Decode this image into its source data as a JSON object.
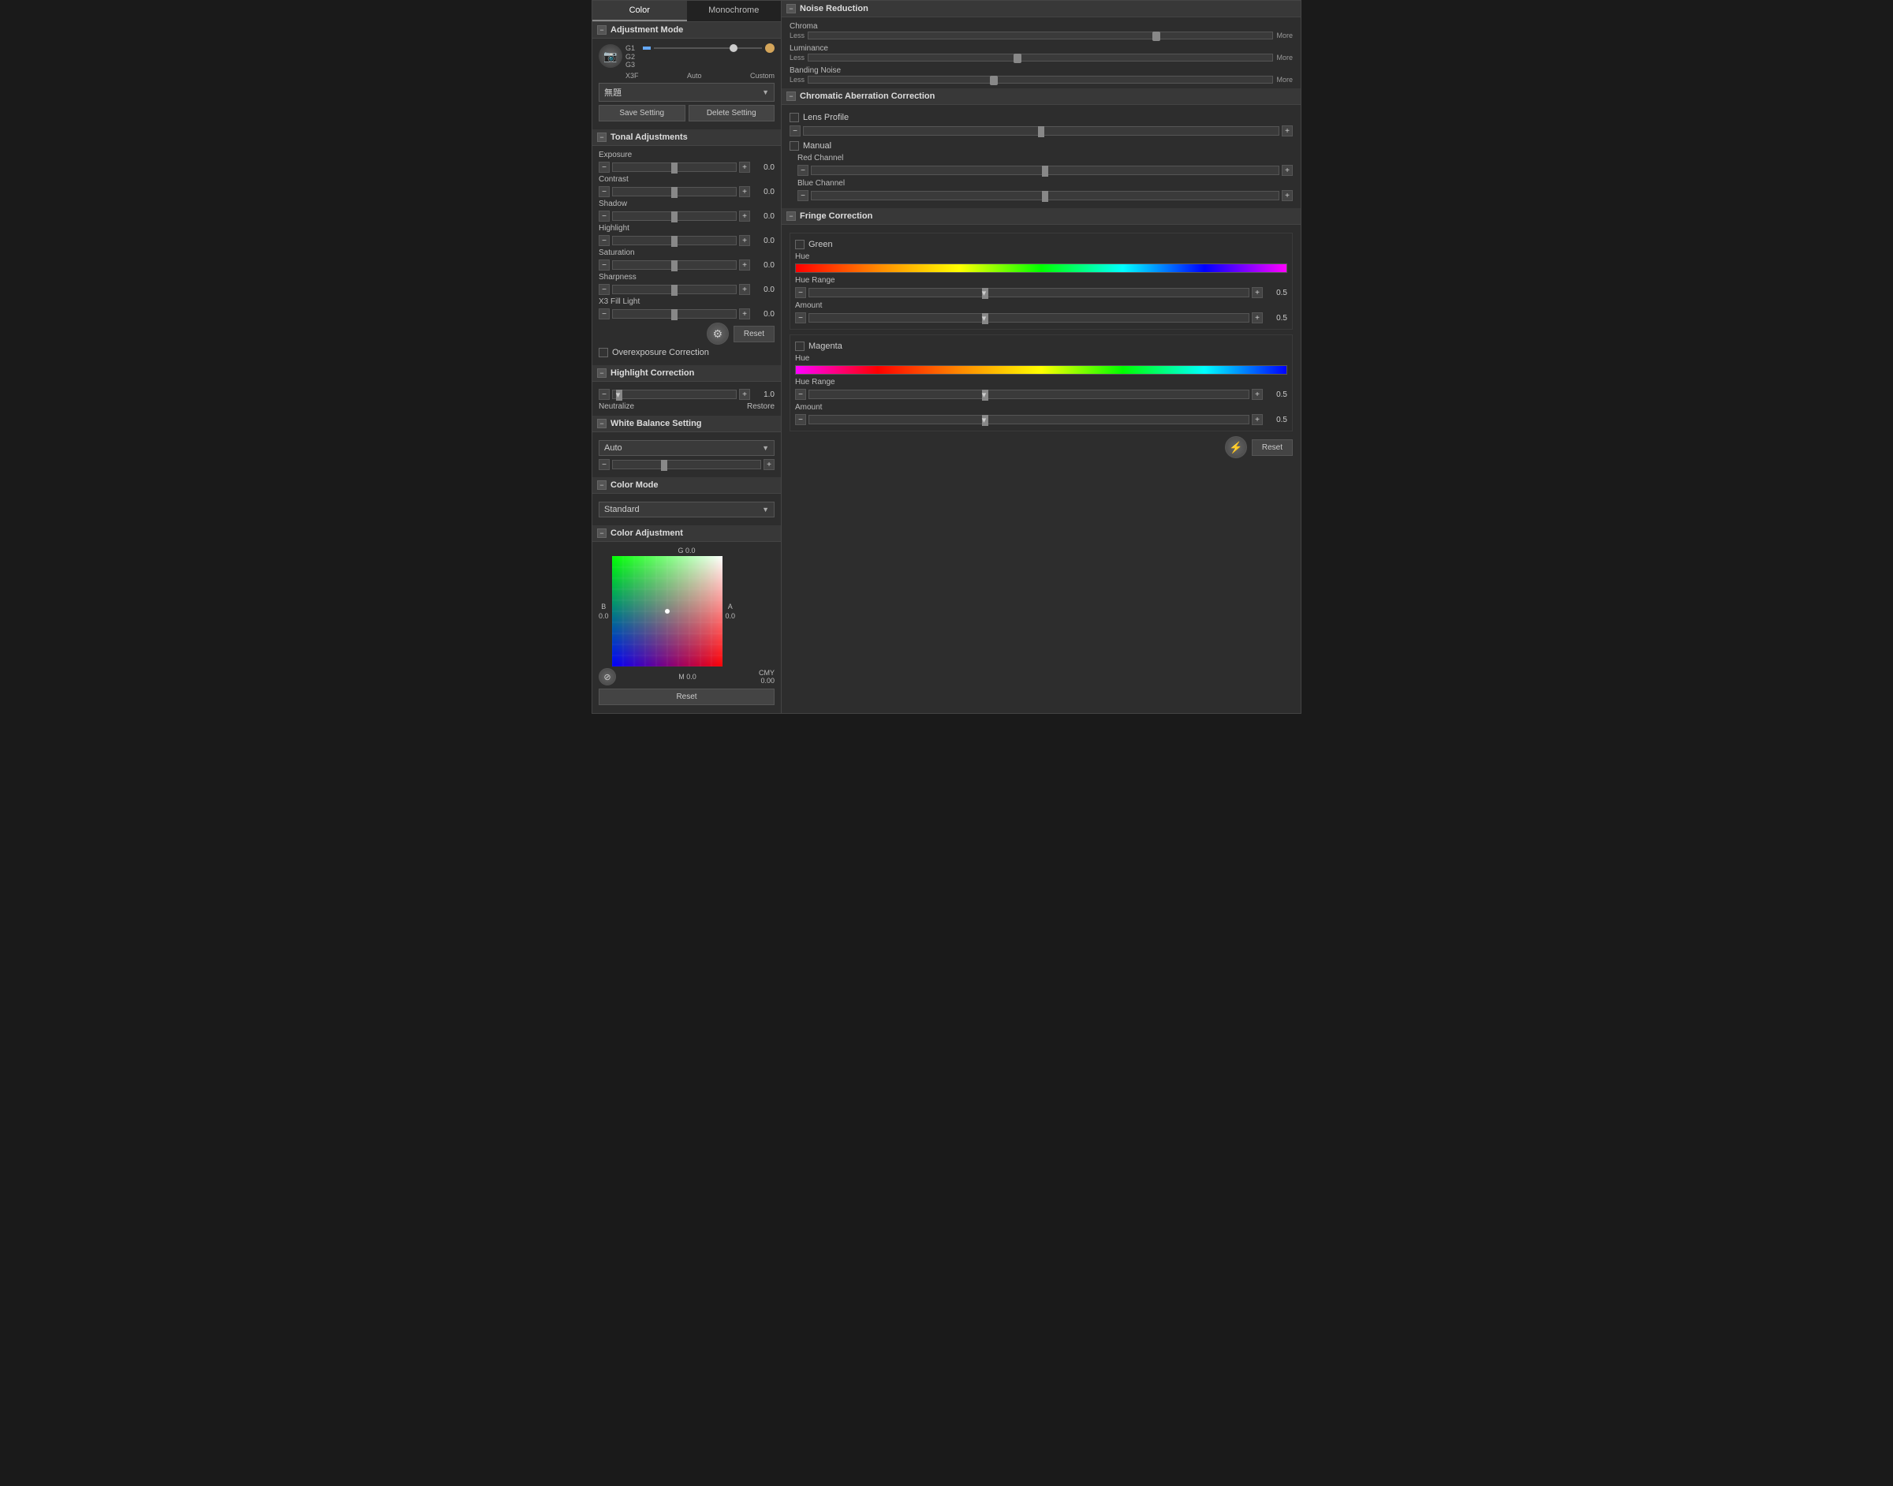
{
  "tabs": {
    "color_label": "Color",
    "monochrome_label": "Monochrome"
  },
  "left_panel": {
    "adjustment_mode": {
      "title": "Adjustment Mode",
      "film_labels": [
        "G1",
        "G2",
        "G3"
      ],
      "mode_labels": [
        "X3F",
        "Auto",
        "Custom"
      ],
      "dropdown_value": "無題",
      "save_button": "Save Setting",
      "delete_button": "Delete Setting"
    },
    "tonal_adjustments": {
      "title": "Tonal Adjustments",
      "sliders": [
        {
          "label": "Exposure",
          "value": "0.0"
        },
        {
          "label": "Contrast",
          "value": "0.0"
        },
        {
          "label": "Shadow",
          "value": "0.0"
        },
        {
          "label": "Highlight",
          "value": "0.0"
        },
        {
          "label": "Saturation",
          "value": "0.0"
        },
        {
          "label": "Sharpness",
          "value": "0.0"
        },
        {
          "label": "X3 Fill Light",
          "value": "0.0"
        }
      ],
      "reset_button": "Reset",
      "overexposure_label": "Overexposure Correction"
    },
    "highlight_correction": {
      "title": "Highlight Correction",
      "value": "1.0",
      "neutralize": "Neutralize",
      "restore": "Restore"
    },
    "white_balance": {
      "title": "White Balance Setting",
      "dropdown_value": "Auto"
    },
    "color_mode": {
      "title": "Color Mode",
      "dropdown_value": "Standard"
    },
    "color_adjustment": {
      "title": "Color Adjustment",
      "g_label": "G 0.0",
      "b_label": "B",
      "b_value": "0.0",
      "a_label": "A",
      "a_value": "0.0",
      "m_label": "M 0.0",
      "cmy_label": "CMY",
      "cmy_value": "0.00",
      "reset_button": "Reset"
    }
  },
  "right_panel": {
    "noise_reduction": {
      "title": "Noise Reduction",
      "sliders": [
        {
          "label": "Chroma",
          "thumb_pos": "75%"
        },
        {
          "label": "Luminance",
          "thumb_pos": "45%"
        },
        {
          "label": "Banding Noise",
          "thumb_pos": "40%"
        }
      ],
      "less": "Less",
      "more": "More"
    },
    "chromatic_aberration": {
      "title": "Chromatic Aberration Correction",
      "lens_profile_label": "Lens Profile",
      "manual_label": "Manual",
      "red_channel_label": "Red Channel",
      "blue_channel_label": "Blue Channel"
    },
    "fringe_correction": {
      "title": "Fringe Correction",
      "green_label": "Green",
      "green_hue_label": "Hue",
      "green_hue_range_label": "Hue Range",
      "green_hue_range_value": "0.5",
      "green_amount_label": "Amount",
      "green_amount_value": "0.5",
      "magenta_label": "Magenta",
      "magenta_hue_label": "Hue",
      "magenta_hue_range_label": "Hue Range",
      "magenta_hue_range_value": "0.5",
      "magenta_amount_label": "Amount",
      "magenta_amount_value": "0.5",
      "reset_button": "Reset"
    }
  }
}
